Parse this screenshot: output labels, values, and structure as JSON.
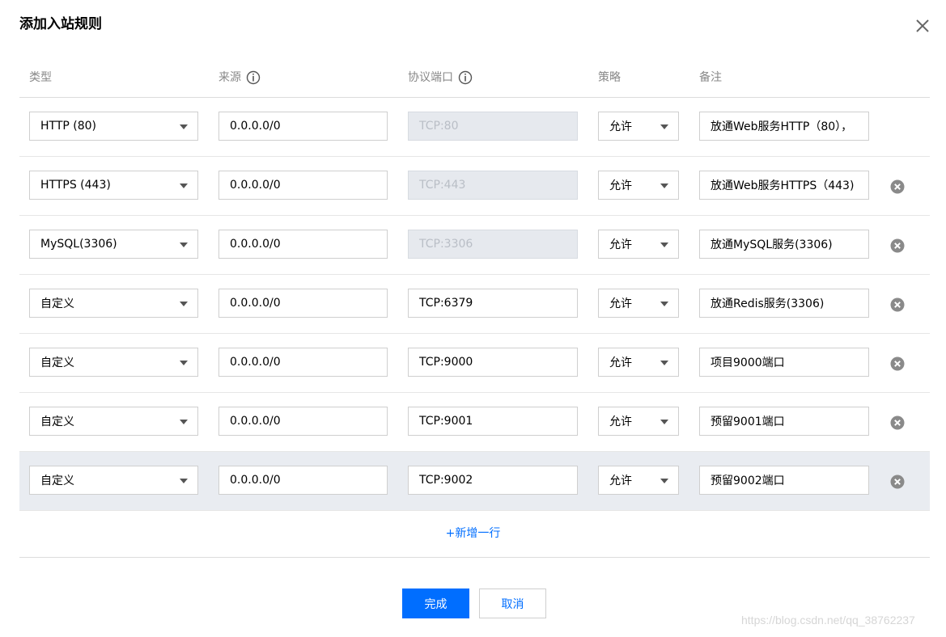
{
  "dialog": {
    "title": "添加入站规则"
  },
  "columns": {
    "type": "类型",
    "source": "来源",
    "port": "协议端口",
    "policy": "策略",
    "remark": "备注"
  },
  "rows": [
    {
      "type": "HTTP (80)",
      "source": "0.0.0.0/0",
      "port": "TCP:80",
      "port_disabled": true,
      "policy": "允许",
      "remark": "放通Web服务HTTP（80），",
      "deletable": false
    },
    {
      "type": "HTTPS (443)",
      "source": "0.0.0.0/0",
      "port": "TCP:443",
      "port_disabled": true,
      "policy": "允许",
      "remark": "放通Web服务HTTPS（443)",
      "deletable": true
    },
    {
      "type": "MySQL(3306)",
      "source": "0.0.0.0/0",
      "port": "TCP:3306",
      "port_disabled": true,
      "policy": "允许",
      "remark": "放通MySQL服务(3306)",
      "deletable": true
    },
    {
      "type": "自定义",
      "source": "0.0.0.0/0",
      "port": "TCP:6379",
      "port_disabled": false,
      "policy": "允许",
      "remark": "放通Redis服务(3306)",
      "deletable": true
    },
    {
      "type": "自定义",
      "source": "0.0.0.0/0",
      "port": "TCP:9000",
      "port_disabled": false,
      "policy": "允许",
      "remark": "项目9000端口",
      "deletable": true
    },
    {
      "type": "自定义",
      "source": "0.0.0.0/0",
      "port": "TCP:9001",
      "port_disabled": false,
      "policy": "允许",
      "remark": "预留9001端口",
      "deletable": true
    },
    {
      "type": "自定义",
      "source": "0.0.0.0/0",
      "port": "TCP:9002",
      "port_disabled": false,
      "policy": "允许",
      "remark": "预留9002端口",
      "deletable": true
    }
  ],
  "actions": {
    "add_row": "+新增一行",
    "confirm": "完成",
    "cancel": "取消"
  },
  "watermark": "https://blog.csdn.net/qq_38762237",
  "colors": {
    "primary": "#006eff",
    "highlight_row": "#e9ecf1",
    "disabled_field": "#e6e9ee"
  },
  "icons": {
    "close": "close-icon",
    "info": "info-circle-icon",
    "delete": "remove-circle-icon",
    "caret": "caret-down-icon"
  }
}
